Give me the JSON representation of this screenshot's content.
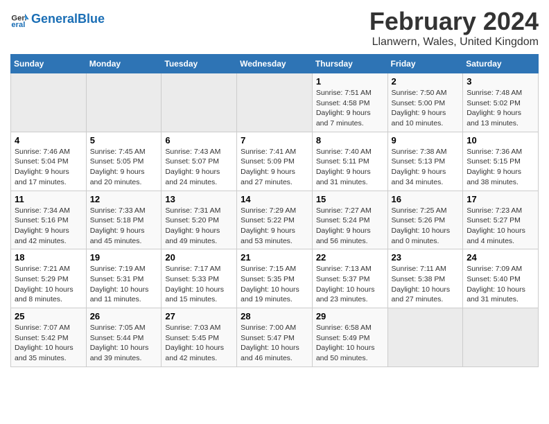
{
  "header": {
    "logo_general": "General",
    "logo_blue": "Blue",
    "month_title": "February 2024",
    "location": "Llanwern, Wales, United Kingdom"
  },
  "weekdays": [
    "Sunday",
    "Monday",
    "Tuesday",
    "Wednesday",
    "Thursday",
    "Friday",
    "Saturday"
  ],
  "weeks": [
    [
      {
        "day": "",
        "info": ""
      },
      {
        "day": "",
        "info": ""
      },
      {
        "day": "",
        "info": ""
      },
      {
        "day": "",
        "info": ""
      },
      {
        "day": "1",
        "info": "Sunrise: 7:51 AM\nSunset: 4:58 PM\nDaylight: 9 hours\nand 7 minutes."
      },
      {
        "day": "2",
        "info": "Sunrise: 7:50 AM\nSunset: 5:00 PM\nDaylight: 9 hours\nand 10 minutes."
      },
      {
        "day": "3",
        "info": "Sunrise: 7:48 AM\nSunset: 5:02 PM\nDaylight: 9 hours\nand 13 minutes."
      }
    ],
    [
      {
        "day": "4",
        "info": "Sunrise: 7:46 AM\nSunset: 5:04 PM\nDaylight: 9 hours\nand 17 minutes."
      },
      {
        "day": "5",
        "info": "Sunrise: 7:45 AM\nSunset: 5:05 PM\nDaylight: 9 hours\nand 20 minutes."
      },
      {
        "day": "6",
        "info": "Sunrise: 7:43 AM\nSunset: 5:07 PM\nDaylight: 9 hours\nand 24 minutes."
      },
      {
        "day": "7",
        "info": "Sunrise: 7:41 AM\nSunset: 5:09 PM\nDaylight: 9 hours\nand 27 minutes."
      },
      {
        "day": "8",
        "info": "Sunrise: 7:40 AM\nSunset: 5:11 PM\nDaylight: 9 hours\nand 31 minutes."
      },
      {
        "day": "9",
        "info": "Sunrise: 7:38 AM\nSunset: 5:13 PM\nDaylight: 9 hours\nand 34 minutes."
      },
      {
        "day": "10",
        "info": "Sunrise: 7:36 AM\nSunset: 5:15 PM\nDaylight: 9 hours\nand 38 minutes."
      }
    ],
    [
      {
        "day": "11",
        "info": "Sunrise: 7:34 AM\nSunset: 5:16 PM\nDaylight: 9 hours\nand 42 minutes."
      },
      {
        "day": "12",
        "info": "Sunrise: 7:33 AM\nSunset: 5:18 PM\nDaylight: 9 hours\nand 45 minutes."
      },
      {
        "day": "13",
        "info": "Sunrise: 7:31 AM\nSunset: 5:20 PM\nDaylight: 9 hours\nand 49 minutes."
      },
      {
        "day": "14",
        "info": "Sunrise: 7:29 AM\nSunset: 5:22 PM\nDaylight: 9 hours\nand 53 minutes."
      },
      {
        "day": "15",
        "info": "Sunrise: 7:27 AM\nSunset: 5:24 PM\nDaylight: 9 hours\nand 56 minutes."
      },
      {
        "day": "16",
        "info": "Sunrise: 7:25 AM\nSunset: 5:26 PM\nDaylight: 10 hours\nand 0 minutes."
      },
      {
        "day": "17",
        "info": "Sunrise: 7:23 AM\nSunset: 5:27 PM\nDaylight: 10 hours\nand 4 minutes."
      }
    ],
    [
      {
        "day": "18",
        "info": "Sunrise: 7:21 AM\nSunset: 5:29 PM\nDaylight: 10 hours\nand 8 minutes."
      },
      {
        "day": "19",
        "info": "Sunrise: 7:19 AM\nSunset: 5:31 PM\nDaylight: 10 hours\nand 11 minutes."
      },
      {
        "day": "20",
        "info": "Sunrise: 7:17 AM\nSunset: 5:33 PM\nDaylight: 10 hours\nand 15 minutes."
      },
      {
        "day": "21",
        "info": "Sunrise: 7:15 AM\nSunset: 5:35 PM\nDaylight: 10 hours\nand 19 minutes."
      },
      {
        "day": "22",
        "info": "Sunrise: 7:13 AM\nSunset: 5:37 PM\nDaylight: 10 hours\nand 23 minutes."
      },
      {
        "day": "23",
        "info": "Sunrise: 7:11 AM\nSunset: 5:38 PM\nDaylight: 10 hours\nand 27 minutes."
      },
      {
        "day": "24",
        "info": "Sunrise: 7:09 AM\nSunset: 5:40 PM\nDaylight: 10 hours\nand 31 minutes."
      }
    ],
    [
      {
        "day": "25",
        "info": "Sunrise: 7:07 AM\nSunset: 5:42 PM\nDaylight: 10 hours\nand 35 minutes."
      },
      {
        "day": "26",
        "info": "Sunrise: 7:05 AM\nSunset: 5:44 PM\nDaylight: 10 hours\nand 39 minutes."
      },
      {
        "day": "27",
        "info": "Sunrise: 7:03 AM\nSunset: 5:45 PM\nDaylight: 10 hours\nand 42 minutes."
      },
      {
        "day": "28",
        "info": "Sunrise: 7:00 AM\nSunset: 5:47 PM\nDaylight: 10 hours\nand 46 minutes."
      },
      {
        "day": "29",
        "info": "Sunrise: 6:58 AM\nSunset: 5:49 PM\nDaylight: 10 hours\nand 50 minutes."
      },
      {
        "day": "",
        "info": ""
      },
      {
        "day": "",
        "info": ""
      }
    ]
  ]
}
